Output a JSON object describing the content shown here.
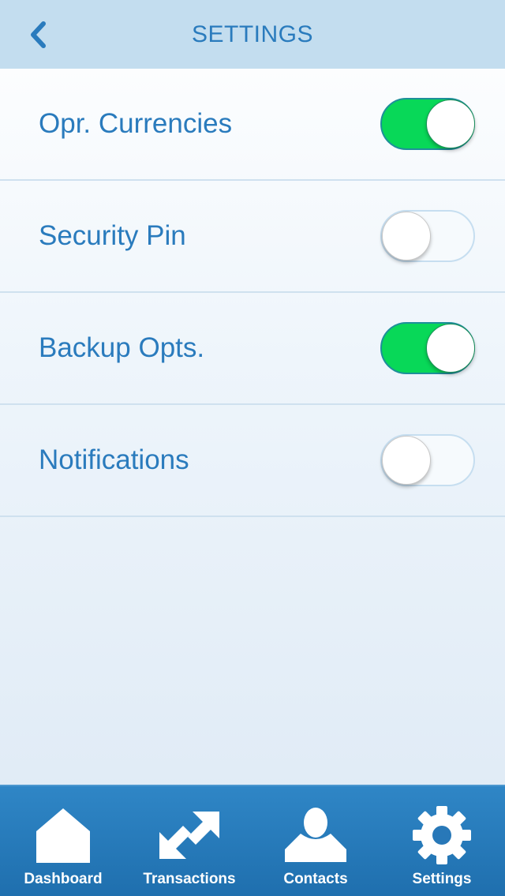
{
  "header": {
    "title": "SETTINGS",
    "back_icon": "chevron-left-icon"
  },
  "settings": [
    {
      "label": "Opr. Currencies",
      "enabled": true
    },
    {
      "label": "Security Pin",
      "enabled": false
    },
    {
      "label": "Backup Opts.",
      "enabled": true
    },
    {
      "label": "Notifications",
      "enabled": false
    }
  ],
  "tabbar": {
    "tabs": [
      {
        "label": "Dashboard",
        "icon": "home-icon"
      },
      {
        "label": "Transactions",
        "icon": "transfer-arrows-icon"
      },
      {
        "label": "Contacts",
        "icon": "person-icon"
      },
      {
        "label": "Settings",
        "icon": "gear-icon",
        "active": true
      }
    ]
  },
  "colors": {
    "accent": "#2a7bbd",
    "toggle_on": "#08d858",
    "navbar_bg": "#c3ddef",
    "tabbar_bg": "#2a7bbd"
  }
}
